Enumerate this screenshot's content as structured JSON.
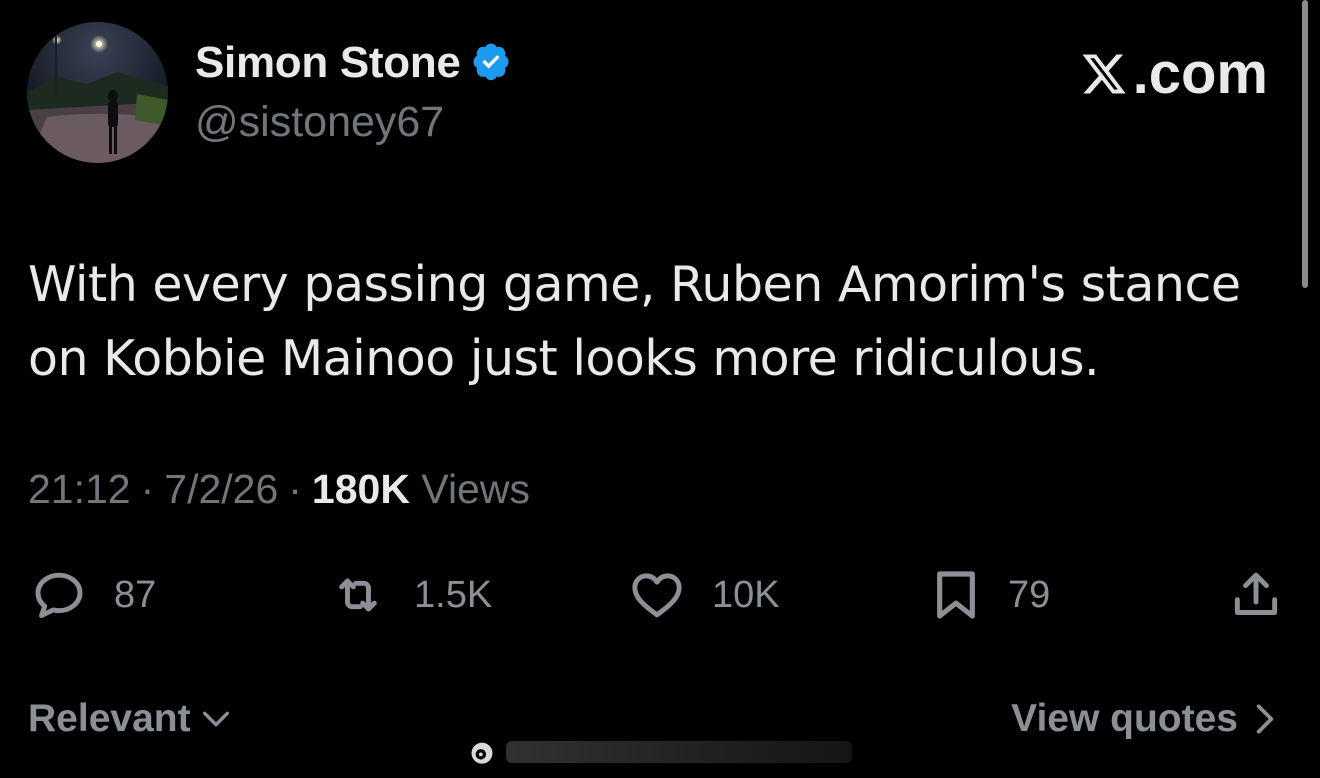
{
  "author": {
    "display_name": "Simon Stone",
    "handle": "@sistoney67",
    "verified": true,
    "verified_color": "#1d9bf0"
  },
  "brand": {
    "label": ".com"
  },
  "tweet": {
    "text": "With every passing game, Ruben Amorim's stance on Kobbie Mainoo just looks more ridiculous."
  },
  "meta": {
    "time": "21:12",
    "separator": "·",
    "date": "7/2/26",
    "views_count": "180K",
    "views_label": "Views"
  },
  "actions": {
    "reply": {
      "icon": "reply-icon",
      "count": "87"
    },
    "repost": {
      "icon": "repost-icon",
      "count": "1.5K"
    },
    "like": {
      "icon": "heart-icon",
      "count": "10K"
    },
    "bookmark": {
      "icon": "bookmark-icon",
      "count": "79"
    },
    "share": {
      "icon": "share-icon"
    }
  },
  "footer": {
    "sort_label": "Relevant",
    "quotes_label": "View quotes"
  },
  "colors": {
    "background": "#000000",
    "text_primary": "#e7e9ea",
    "text_secondary": "#71767b"
  }
}
